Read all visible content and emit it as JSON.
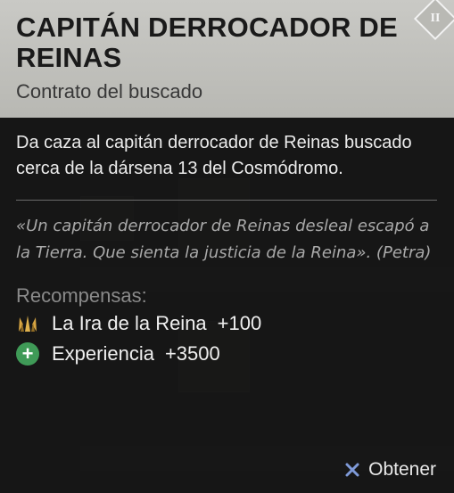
{
  "item": {
    "title": "CAPITÁN DERROCADOR DE REINAS",
    "subtitle": "Contrato del buscado",
    "corner_icon": "ii-diamond-icon",
    "corner_label": "II"
  },
  "description": "Da caza al capitán derrocador de Reinas buscado cerca de la dársena 13 del Cosmódromo.",
  "quote": "«Un capitán derrocador de Reinas desleal escapó a la Tierra. Que sienta la justicia de la Reina». (Petra)",
  "rewards": {
    "label": "Recompensas:",
    "items": [
      {
        "icon": "queens-crown-icon",
        "name": "La Ira de la Reina",
        "amount": "+100"
      },
      {
        "icon": "plus-circle-icon",
        "name": "Experiencia",
        "amount": "+3500"
      }
    ]
  },
  "action": {
    "button_icon": "cross-button-icon",
    "label": "Obtener"
  },
  "colors": {
    "header_bg": "#c1c1bd",
    "body_bg": "#141414",
    "plus_green": "#3f9a57",
    "crown_gold": "#c99a3a",
    "cross_blue": "#7f9ad8"
  }
}
